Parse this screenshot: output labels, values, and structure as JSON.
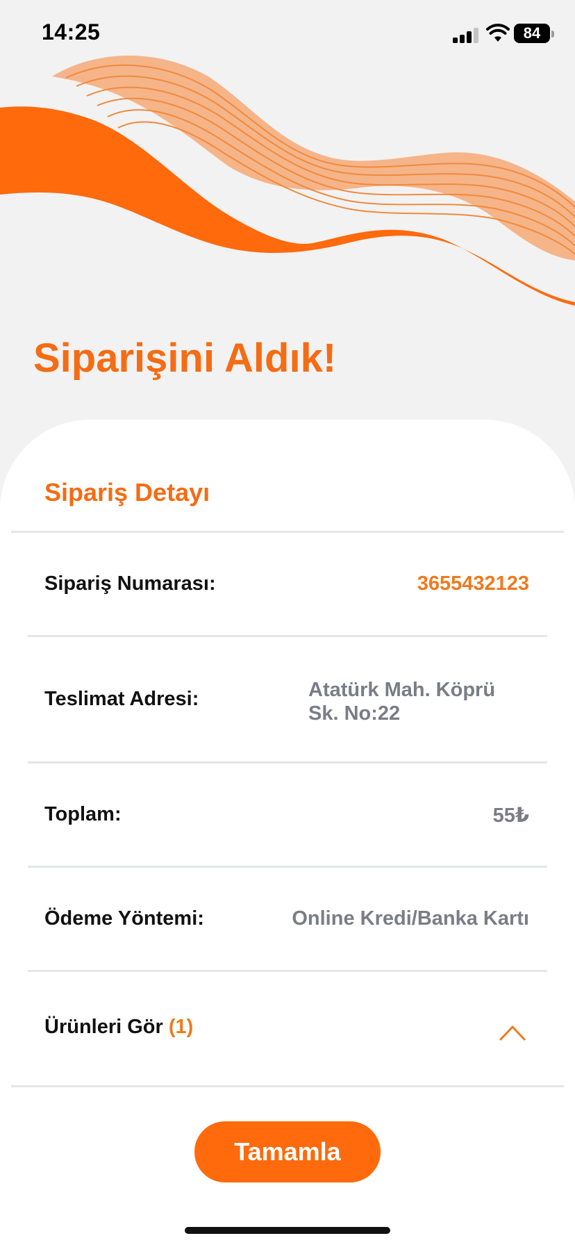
{
  "status_bar": {
    "time": "14:25",
    "battery": "84"
  },
  "page_title": "Siparişini Aldık!",
  "card": {
    "title": "Sipariş Detayı",
    "order_number": {
      "label": "Sipariş Numarası:",
      "value": "3655432123"
    },
    "delivery_address": {
      "label": "Teslimat Adresi:",
      "value": "Atatürk Mah. Köprü Sk. No:22"
    },
    "total": {
      "label": "Toplam:",
      "value": "55₺"
    },
    "payment_method": {
      "label": "Ödeme Yöntemi:",
      "value": "Online Kredi/Banka Kartı"
    },
    "products": {
      "label": "Ürünleri Gör",
      "count": "(1)"
    }
  },
  "complete_button": {
    "label": "Tamamla"
  },
  "colors": {
    "accent": "#f46c14",
    "button": "#ff6a0c",
    "muted_text": "#7a7d86"
  }
}
